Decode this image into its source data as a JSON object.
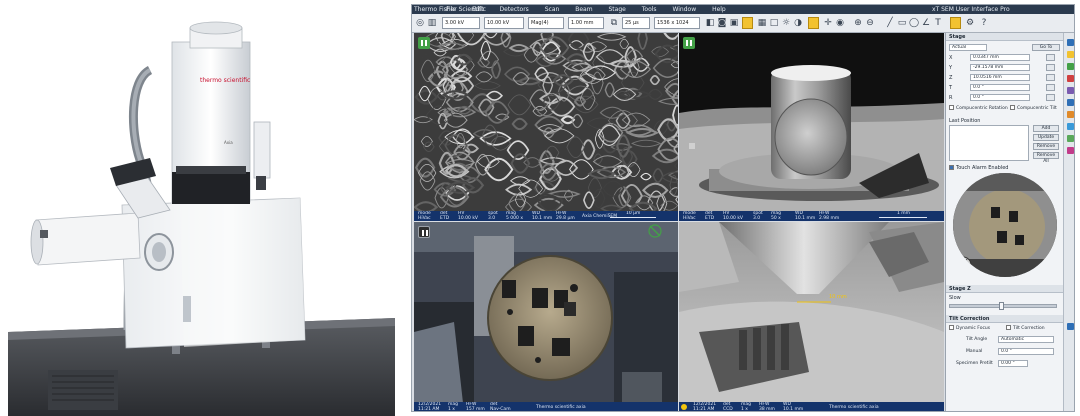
{
  "instrument": {
    "brand_label": "thermo scientific",
    "model_label": "Axia"
  },
  "app": {
    "title": "Thermo Fisher Scientific",
    "title_right": "xT SEM User Interface  Pro",
    "menus": [
      "File",
      "Edit",
      "Detectors",
      "Scan",
      "Beam",
      "Stage",
      "Tools",
      "Window",
      "Help"
    ],
    "toolbar": {
      "fields": [
        "3.00 kV",
        "10.00 kV",
        "Mag(4)",
        "1.00 mm",
        "25 µs",
        "1536 x 1024"
      ]
    },
    "quadrants": [
      {
        "name": "sem-image",
        "paused": true,
        "databar": {
          "cells": [
            [
              "mode",
              "HiVac"
            ],
            [
              "det",
              "ETD"
            ],
            [
              "HV",
              "10.00 kV"
            ],
            [
              "spot",
              "3.0"
            ],
            [
              "mag",
              "5 000 x"
            ],
            [
              "WD",
              "10.1 mm"
            ],
            [
              "HFW",
              "29.8 µm"
            ]
          ],
          "scale": "10 µm",
          "tail": "Axia ChemiSEM"
        }
      },
      {
        "name": "ccd-image",
        "paused": true,
        "databar": {
          "cells": [
            [
              "mode",
              "HiVac"
            ],
            [
              "det",
              "ETD"
            ],
            [
              "HV",
              "10.00 kV"
            ],
            [
              "spot",
              "3.0"
            ],
            [
              "mag",
              "50 x"
            ],
            [
              "WD",
              "10.1 mm"
            ],
            [
              "HFW",
              "2.98 mm"
            ]
          ],
          "scale": "1 mm",
          "tail": ""
        }
      },
      {
        "name": "chamber-camera",
        "paused": false,
        "databar": {
          "cells": [
            [
              "date",
              "12/2/2021"
            ],
            [
              "time",
              "11:21 AM"
            ],
            [
              "mag",
              "1 x"
            ],
            [
              "HFW",
              "157 mm"
            ],
            [
              "det",
              "Nav-Cam"
            ]
          ],
          "scale": "",
          "tail": "Thermo scientific axia"
        }
      },
      {
        "name": "ir-camera",
        "paused": false,
        "measure": "10 mm",
        "databar": {
          "cells": [
            [
              "date",
              "12/2/2021"
            ],
            [
              "time",
              "11:21 AM"
            ],
            [
              "det",
              "CCD"
            ],
            [
              "mag",
              "1 x"
            ],
            [
              "HFW",
              "38 mm"
            ],
            [
              "WD",
              "10.1 mm"
            ]
          ],
          "scale": "",
          "tail": "Thermo scientific axia"
        }
      }
    ],
    "panel": {
      "stage_header": "Stage",
      "actual_label": "Actual",
      "goto_label": "Go To",
      "coords": [
        {
          "axis": "X",
          "value": "0.0347 mm"
        },
        {
          "axis": "Y",
          "value": "-29.1578 mm"
        },
        {
          "axis": "Z",
          "value": "10.0516 mm"
        },
        {
          "axis": "T",
          "value": "0.0 °"
        },
        {
          "axis": "R",
          "value": "0.0 °"
        }
      ],
      "compucentric": "Compucentric Rotation",
      "compucentric2": "Compucentric Tilt",
      "positions_label": "Last Position",
      "position_buttons": [
        "Add",
        "Update",
        "Remove",
        "Remove All"
      ],
      "touch_alarm": "Touch Alarm Enabled",
      "stage_z_header": "Stage Z",
      "stage_z_label": "Slow",
      "tilt_header": "Tilt Correction",
      "tilt_options": [
        "Dynamic Focus",
        "Tilt Correction"
      ],
      "tilt_angle_label": "Tilt Angle",
      "tilt_angle_value": "Automatic",
      "manual_label": "Manual",
      "manual_value": "0.0 °",
      "specimen_label": "Specimen Pretilt",
      "specimen_value": "0.00 °"
    },
    "sidebar_icon_colors": [
      "#2f6fb6",
      "#f2c230",
      "#43a047",
      "#d04040",
      "#7a5bb0",
      "#2f6fb6",
      "#e08a2a",
      "#3a9ad9",
      "#5aa85a",
      "#c23b8a",
      "#2f6fb6"
    ]
  }
}
